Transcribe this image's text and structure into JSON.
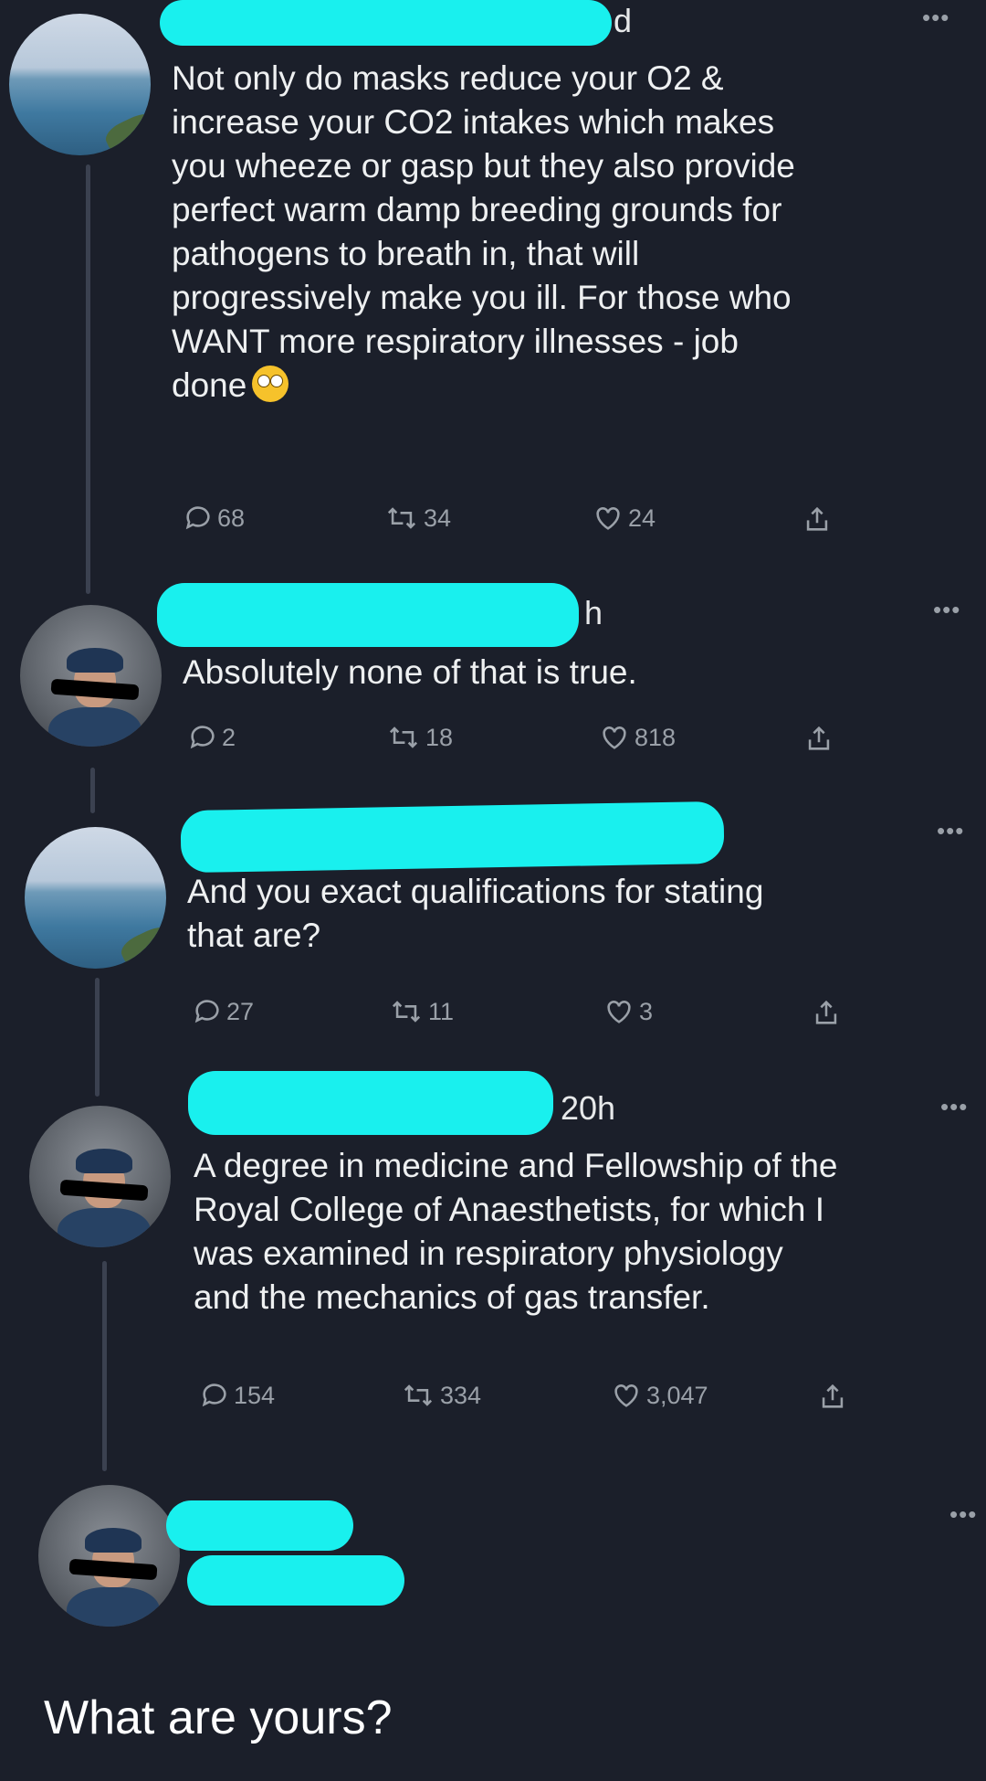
{
  "tweets": [
    {
      "time": "d",
      "text_lines": [
        "Not only do masks reduce your O2 &",
        "increase your CO2 intakes which makes",
        "you wheeze or gasp but they also provide",
        "perfect warm damp breeding grounds for",
        "pathogens to breath in, that will",
        "progressively make you ill. For those who",
        "WANT more respiratory illnesses - job",
        "done"
      ],
      "emoji": "face-with-rolling-eyes",
      "replies": "68",
      "retweets": "34",
      "likes": "24"
    },
    {
      "time": "h",
      "text_lines": [
        "Absolutely none of that is true."
      ],
      "replies": "2",
      "retweets": "18",
      "likes": "818"
    },
    {
      "time": "",
      "text_lines": [
        "And you exact qualifications for stating",
        "that are?"
      ],
      "replies": "27",
      "retweets": "11",
      "likes": "3"
    },
    {
      "time": "20h",
      "text_lines": [
        "A degree in medicine and Fellowship of the",
        "Royal College of Anaesthetists, for which I",
        "was examined in respiratory physiology",
        "and the mechanics of gas transfer."
      ],
      "replies": "154",
      "retweets": "334",
      "likes": "3,047"
    }
  ],
  "more_label": "•••",
  "final_text": "What are yours?",
  "colors": {
    "background": "#1b1f2a",
    "redaction": "#19f0ee",
    "muted": "#9aa0a8"
  }
}
